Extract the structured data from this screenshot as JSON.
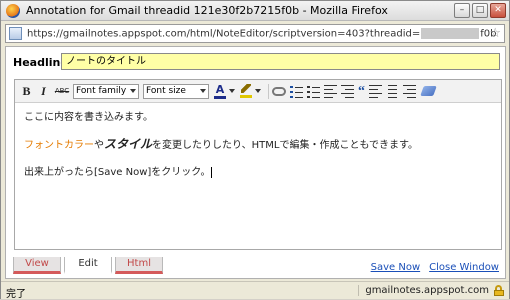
{
  "window": {
    "title": "Annotation for Gmail threadid 121e30f2b7215f0b - Mozilla Firefox"
  },
  "urlbar": {
    "url_prefix": "https://gmailnotes.appspot.com/html/NoteEditor/scriptversion=403?threadid=",
    "url_suffix": "f0b"
  },
  "headline": {
    "label": "Headline",
    "value": "ノートのタイトル"
  },
  "toolbar": {
    "bold": "B",
    "italic": "I",
    "strike": "ABC",
    "font_family": "Font family",
    "font_size": "Font size",
    "font_color_glyph": "A"
  },
  "editor": {
    "line1": "ここに内容を書き込みます。",
    "line2_orange": "フォントカラー",
    "line2_mid1": "や",
    "line2_style": "スタイル",
    "line2_rest": "を変更したりしたり、HTMLで編集・作成こともできます。",
    "line3": "出来上がったら[Save Now]をクリック。"
  },
  "tabs": [
    {
      "label": "View"
    },
    {
      "label": "Edit"
    },
    {
      "label": "Html"
    }
  ],
  "actions": {
    "save_now": "Save Now",
    "close_window": "Close Window"
  },
  "status": {
    "left": "完了",
    "domain": "gmailnotes.appspot.com"
  },
  "colors": {
    "headline_bg": "#ffffa6",
    "tab_accent": "#d45a5a",
    "link": "#1a4fb8",
    "orange_text": "#e47b00"
  },
  "icons": [
    "firefox-icon",
    "minimize-icon",
    "maximize-icon",
    "close-icon",
    "site-icon",
    "bookmark-star-icon",
    "lock-icon"
  ]
}
